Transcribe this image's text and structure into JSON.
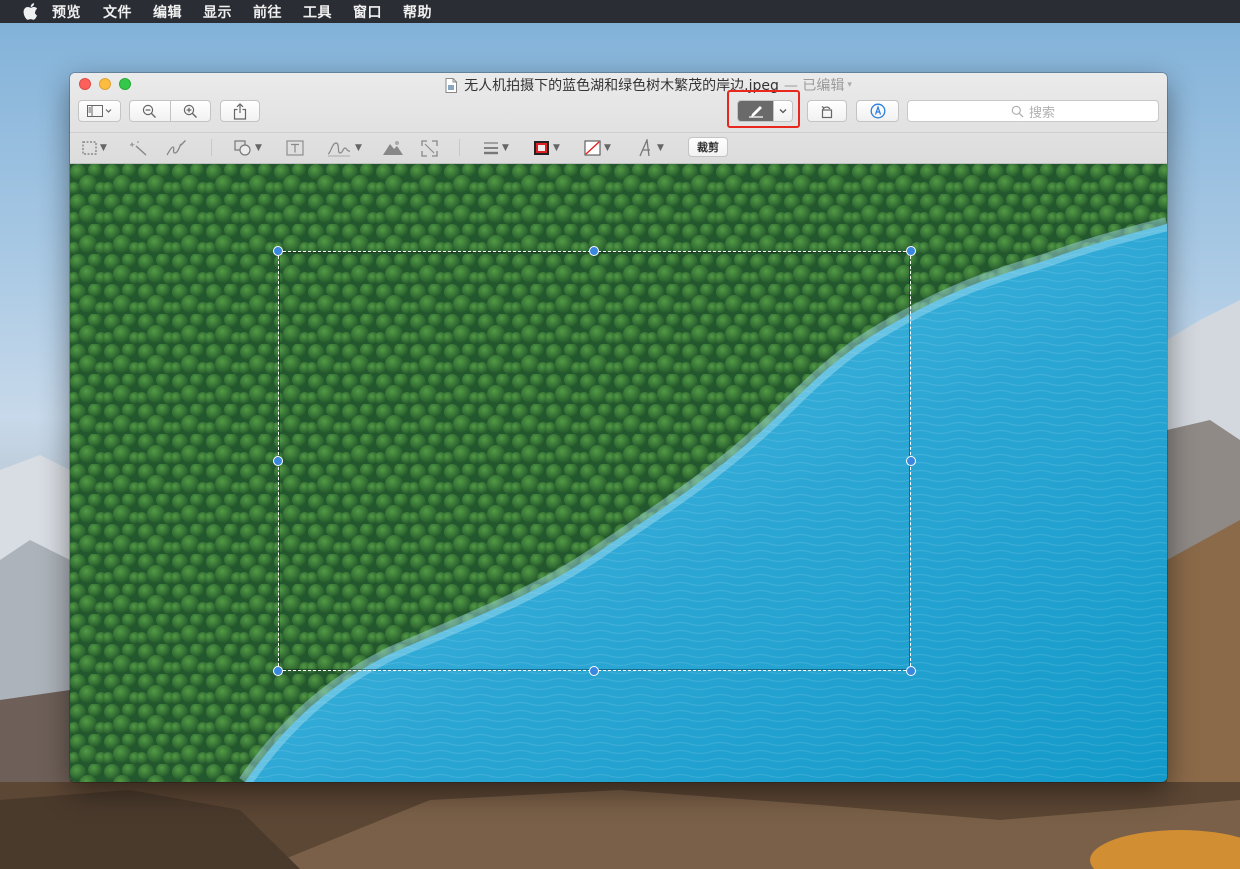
{
  "menubar": {
    "app_name": "预览",
    "items": [
      "文件",
      "编辑",
      "显示",
      "前往",
      "工具",
      "窗口",
      "帮助"
    ]
  },
  "window": {
    "title": "无人机拍摄下的蓝色湖和绿色树木繁茂的岸边.jpeg",
    "edited": "— 已编辑",
    "search_placeholder": "搜索",
    "crop_label": "裁剪"
  },
  "icons": {
    "apple": "apple-logo-icon",
    "sidebar": "sidebar-icon",
    "zoom_out": "zoom-out-icon",
    "zoom_in": "zoom-in-icon",
    "share": "share-icon",
    "markup": "markup-pen-icon",
    "rotate": "rotate-icon",
    "annotate": "annotate-icon",
    "search": "search-icon"
  },
  "colors": {
    "menubar": "#2a2d33",
    "highlight": "#e8271f",
    "selection_handle": "#3a87e0",
    "lake": "#2aa6d6",
    "forest": "#2e6b38"
  }
}
